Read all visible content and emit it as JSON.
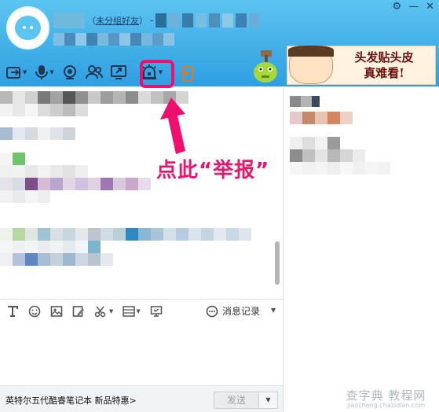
{
  "header": {
    "group_link": "未分组好友",
    "group_open": "（",
    "group_close": "）",
    "separator": "-",
    "window_controls": {
      "gear": "⚙",
      "minimize": "—",
      "close": "✕"
    }
  },
  "toolbar": {
    "items": [
      {
        "icon": "transfer-file-icon",
        "has_menu": true
      },
      {
        "icon": "voice-call-icon",
        "has_menu": true
      },
      {
        "icon": "video-call-icon",
        "has_menu": false
      },
      {
        "icon": "group-chat-icon",
        "has_menu": false
      },
      {
        "icon": "remote-desktop-icon",
        "has_menu": false
      },
      {
        "icon": "report-icon",
        "has_menu": true
      },
      {
        "icon": "app-icon",
        "has_menu": false
      }
    ]
  },
  "ad": {
    "line1": "头发贴头皮",
    "line2": "真难看!"
  },
  "annotation": {
    "text": "点此“举报”",
    "color": "#e8176e"
  },
  "input_toolbar": {
    "history_label": "消息记录",
    "icons": [
      "font-icon",
      "emoji-icon",
      "image-icon",
      "scribble-icon",
      "screenshot-icon",
      "more-icon",
      "shake-icon"
    ]
  },
  "bottom": {
    "promo_text": "英特尔五代酷睿笔记本 新品特惠>",
    "send_label": "发送",
    "send_menu": "▼"
  },
  "watermark": {
    "main": "查字典 教程网",
    "sub": "jiaocheng.chazidian.com"
  },
  "colors": {
    "header_top": "#5cc4f0",
    "header_bottom": "#2f9fe2",
    "highlight": "#ee0f6f"
  }
}
